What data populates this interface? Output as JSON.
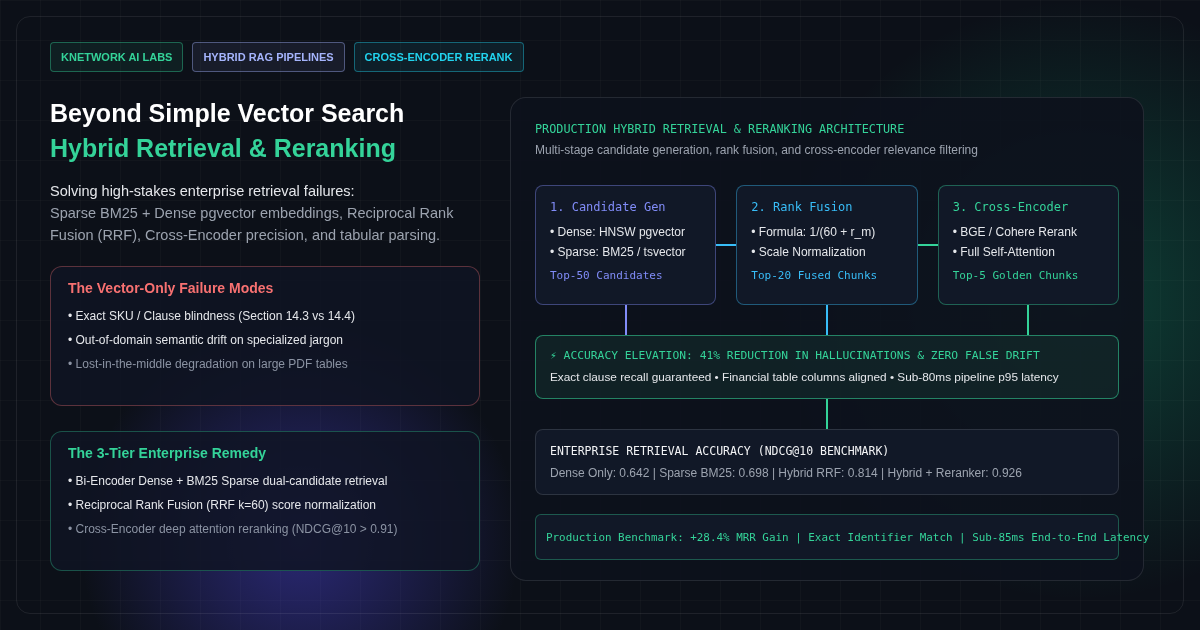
{
  "tags": [
    {
      "label": "KNETWORK AI LABS",
      "color": "#34d399"
    },
    {
      "label": "HYBRID RAG PIPELINES",
      "color": "#a5b4fc"
    },
    {
      "label": "CROSS-ENCODER RERANK",
      "color": "#22d3ee"
    }
  ],
  "title": "Beyond Simple Vector Search",
  "subtitle": "Hybrid Retrieval & Reranking",
  "intro": {
    "lead": "Solving high-stakes enterprise retrieval failures:",
    "body": "Sparse BM25 + Dense pgvector embeddings, Reciprocal Rank Fusion (RRF), Cross-Encoder precision, and tabular parsing."
  },
  "cards": [
    {
      "title": "The Vector-Only Failure Modes",
      "color": "#f87171",
      "items": [
        {
          "text": "• Exact SKU / Clause blindness (Section 14.3 vs 14.4)",
          "faded": false
        },
        {
          "text": "• Out-of-domain semantic drift on specialized jargon",
          "faded": false
        },
        {
          "text": "• Lost-in-the-middle degradation on large PDF tables",
          "faded": true
        }
      ]
    },
    {
      "title": "The 3-Tier Enterprise Remedy",
      "color": "#34d399",
      "items": [
        {
          "text": "• Bi-Encoder Dense + BM25 Sparse dual-candidate retrieval",
          "faded": false
        },
        {
          "text": "• Reciprocal Rank Fusion (RRF k=60) score normalization",
          "faded": false
        },
        {
          "text": "• Cross-Encoder deep attention reranking (NDCG@10 > 0.91)",
          "faded": true
        }
      ]
    }
  ],
  "architecture": {
    "title": "PRODUCTION HYBRID RETRIEVAL & RERANKING ARCHITECTURE",
    "subtitle": "Multi-stage candidate generation, rank fusion, and cross-encoder relevance filtering",
    "stages": [
      {
        "title": "1. Candidate Gen",
        "color": "#818cf8",
        "items": [
          "• Dense: HNSW pgvector",
          "• Sparse: BM25 / tsvector"
        ],
        "output": "Top-50 Candidates"
      },
      {
        "title": "2. Rank Fusion",
        "color": "#38bdf8",
        "items": [
          "• Formula: 1/(60 + r_m)",
          "• Scale Normalization"
        ],
        "output": "Top-20 Fused Chunks"
      },
      {
        "title": "3. Cross-Encoder",
        "color": "#34d399",
        "items": [
          "• BGE / Cohere Rerank",
          "• Full Self-Attention"
        ],
        "output": "Top-5 Golden Chunks"
      }
    ],
    "elevation": {
      "title": "⚡ ACCURACY ELEVATION: 41% REDUCTION IN HALLUCINATIONS & ZERO FALSE DRIFT",
      "text": "Exact clause recall guaranteed • Financial table columns aligned • Sub-80ms pipeline p95 latency"
    },
    "accuracy": {
      "title": "ENTERPRISE RETRIEVAL ACCURACY (NDCG@10 BENCHMARK)",
      "text": "Dense Only: 0.642 | Sparse BM25: 0.698 | Hybrid RRF: 0.814 | Hybrid + Reranker: 0.926"
    },
    "benchmark": "Production Benchmark: +28.4% MRR Gain | Exact Identifier Match | Sub-85ms End-to-End Latency"
  }
}
